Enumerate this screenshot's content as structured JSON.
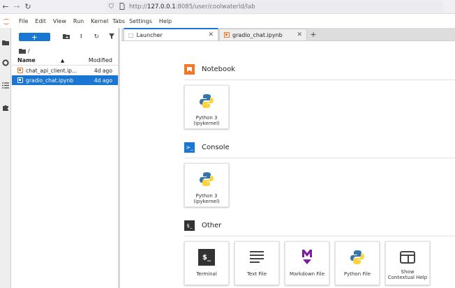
{
  "browser": {
    "url_prefix": "http://",
    "url_host": "127.0.0.1",
    "url_rest": ":8085/user/coolwaterld/lab"
  },
  "menu": [
    "File",
    "Edit",
    "View",
    "Run",
    "Kernel",
    "Tabs",
    "Settings",
    "Help"
  ],
  "filebrowser": {
    "new_label": "+",
    "breadcrumb": "/",
    "col_name": "Name",
    "col_modified": "Modified",
    "files": [
      {
        "name": "chat_api_client.ip...",
        "modified": "4d ago",
        "selected": false
      },
      {
        "name": "gradio_chat.ipynb",
        "modified": "4d ago",
        "selected": true
      }
    ]
  },
  "tabs": [
    {
      "label": "Launcher",
      "active": true
    },
    {
      "label": "gradio_chat.ipynb",
      "active": false
    }
  ],
  "launcher": {
    "sections": [
      {
        "title": "Notebook",
        "cards": [
          "Python 3\n(ipykernel)"
        ]
      },
      {
        "title": "Console",
        "cards": [
          "Python 3\n(ipykernel)"
        ]
      },
      {
        "title": "Other",
        "cards": [
          "Terminal",
          "Text File",
          "Markdown File",
          "Python File",
          "Show Contextual Help"
        ]
      }
    ]
  },
  "colors": {
    "accent": "#1976d2",
    "jupyter_orange": "#f37726",
    "markdown_purple": "#7b1fa2"
  }
}
